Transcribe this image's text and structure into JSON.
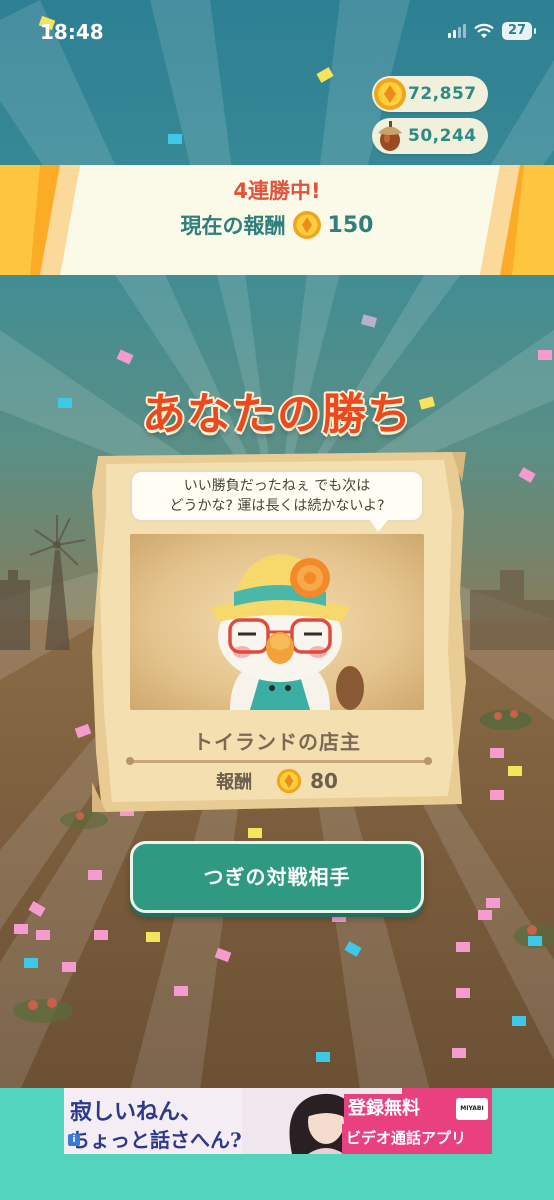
{
  "status_bar": {
    "time": "18:48",
    "battery": "27"
  },
  "currency": {
    "coins": "72,857",
    "acorns": "50,244"
  },
  "streak": {
    "title": "4連勝中!",
    "reward_label": "現在の報酬",
    "reward_value": "150"
  },
  "result": {
    "title": "あなたの勝ち"
  },
  "opponent": {
    "speech_line1": "いい勝負だったねぇ でも次は",
    "speech_line2": "どうかな? 運は長くは続かないよ?",
    "name": "トイランドの店主",
    "reward_label": "報酬",
    "reward_value": "80"
  },
  "actions": {
    "next_opponent": "つぎの対戦相手"
  },
  "ad": {
    "line1": "寂しいねん、",
    "line2": "ちょっと話さへん?",
    "cta_top": "登録無料",
    "cta_bottom": "ビデオ通話アプリ",
    "logo": "MIYABI"
  },
  "colors": {
    "accent_teal": "#2f9982",
    "title_orange": "#ec4a1e",
    "streak_red": "#e2533d",
    "ad_pink": "#e9407f"
  }
}
